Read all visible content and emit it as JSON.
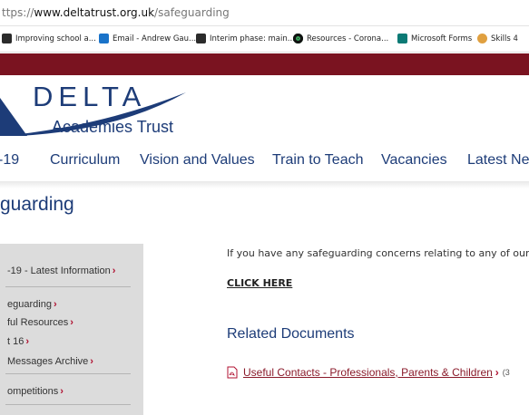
{
  "browser": {
    "url_prefix": "ttps://",
    "url_domain": "www.deltatrust.org.uk",
    "url_path": "/safeguarding",
    "bookmarks": [
      {
        "label": "Improving school a...",
        "icon": "school-icon",
        "color": "#2b2b2b"
      },
      {
        "label": "Email - Andrew Gau...",
        "icon": "outlook-icon",
        "color": "#1a73c9"
      },
      {
        "label": "Interim phase: main...",
        "icon": "document-icon",
        "color": "#2b2b2b"
      },
      {
        "label": "Resources - Corona...",
        "icon": "resources-icon",
        "color": "#111111"
      },
      {
        "label": "Microsoft Forms",
        "icon": "forms-icon",
        "color": "#0b7a75"
      },
      {
        "label": "Skills 4",
        "icon": "skills-icon",
        "color": "#e0a040"
      }
    ]
  },
  "brand": {
    "name": "DELTA",
    "subtitle": "Academies Trust",
    "primary": "#1d3c78",
    "accent": "#7a1320"
  },
  "nav": {
    "items": [
      "-19",
      "Curriculum",
      "Vision and Values",
      "Train to Teach",
      "Vacancies",
      "Latest Ne"
    ]
  },
  "page": {
    "title": "guarding"
  },
  "sidebar": {
    "items": [
      "-19 - Latest Information",
      "eguarding",
      "ful Resources",
      "t 16",
      " Messages Archive",
      "ompetitions"
    ]
  },
  "main": {
    "intro": "If you have any safeguarding concerns relating to any of our sc",
    "click_here": "CLICK HERE",
    "related_heading": "Related Documents",
    "document": {
      "label": "Useful Contacts - Professionals, Parents & Children",
      "size": "(3"
    }
  }
}
